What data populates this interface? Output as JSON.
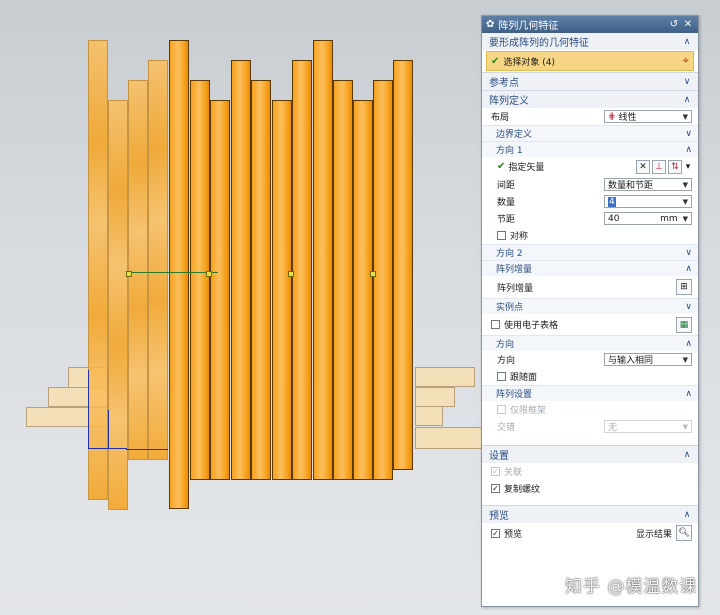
{
  "dialog": {
    "title": "阵列几何特征",
    "groups": {
      "target": {
        "label": "要形成阵列的几何特征",
        "select_label": "选择对象 (4)"
      },
      "ref_point": {
        "label": "参考点"
      },
      "definition": {
        "label": "阵列定义",
        "layout_label": "布局",
        "layout_value": "线性",
        "boundary": {
          "label": "边界定义"
        },
        "dir1": {
          "label": "方向 1",
          "vector_label": "指定矢量",
          "spacing_label": "间距",
          "spacing_value": "数量和节距",
          "count_label": "数量",
          "count_value": "4",
          "pitch_label": "节距",
          "pitch_value": "40",
          "pitch_unit": "mm",
          "symmetric_label": "对称"
        },
        "dir2": {
          "label": "方向 2"
        },
        "increment": {
          "label": "阵列增量",
          "row_label": "阵列增量"
        },
        "instance": {
          "label": "实例点",
          "spreadsheet_label": "使用电子表格"
        },
        "orientation": {
          "label": "方向",
          "dir_label": "方向",
          "dir_value": "与输入相同",
          "follow_label": "跟随面"
        },
        "settings": {
          "label": "阵列设置",
          "frame_only_label": "仅限框架",
          "stagger_label": "交错",
          "stagger_value": "无"
        }
      },
      "settings": {
        "label": "设置",
        "assoc_label": "关联",
        "copy_thread_label": "复制螺纹"
      },
      "preview": {
        "label": "预览",
        "preview_label": "预览",
        "show_result_label": "显示结果"
      }
    }
  },
  "watermark": "知乎 @模温数课",
  "colors": {
    "bar_light": "#fbbf5e",
    "bar_mid": "#f6a21d",
    "bar_dark": "#e98b07",
    "plank": "#f3dfb8",
    "title_bar": "#4f6f96",
    "highlight": "#f6d684"
  }
}
